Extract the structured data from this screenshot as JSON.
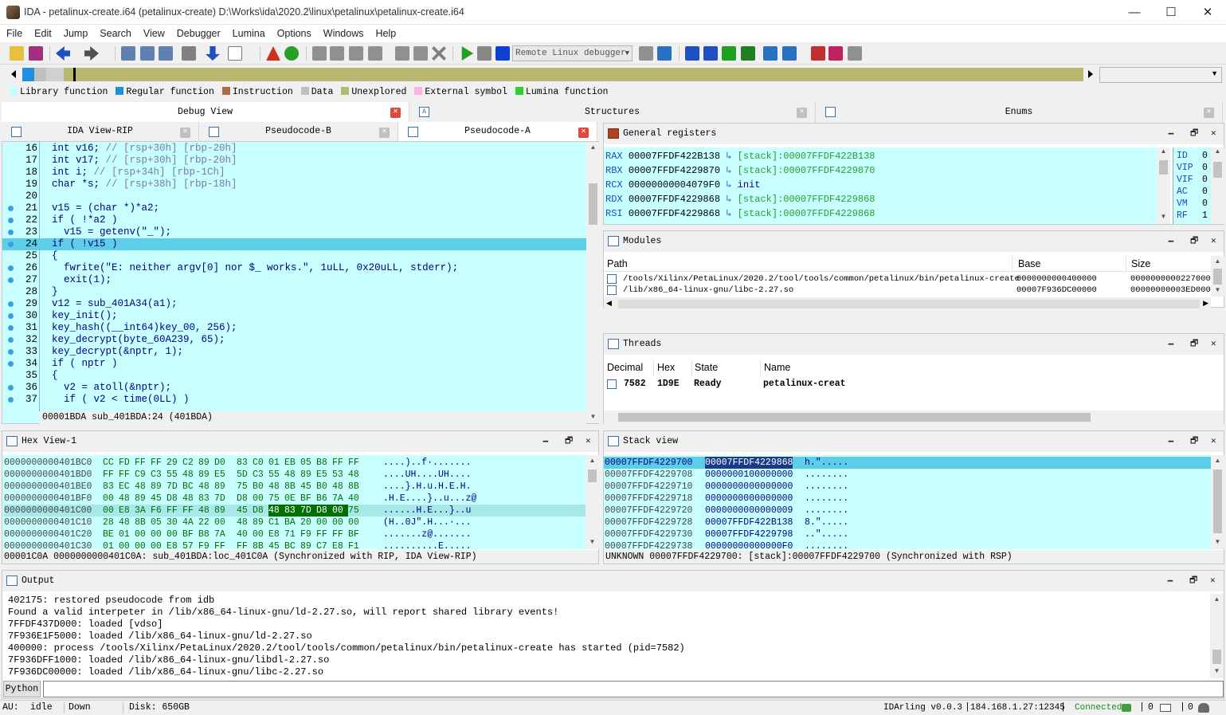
{
  "window": {
    "title": "IDA - petalinux-create.i64 (petalinux-create) D:\\Works\\ida\\2020.2\\linux\\petalinux\\petalinux-create.i64",
    "minimize": "—",
    "maximize": "☐",
    "close": "✕"
  },
  "menu": [
    "File",
    "Edit",
    "Jump",
    "Search",
    "View",
    "Debugger",
    "Lumina",
    "Options",
    "Windows",
    "Help"
  ],
  "toolbar": {
    "debugger_combo": "Remote Linux debugger"
  },
  "legend": [
    {
      "label": "Library function",
      "color": "#bfffff"
    },
    {
      "label": "Regular function",
      "color": "#1e90e0"
    },
    {
      "label": "Instruction",
      "color": "#b0684a"
    },
    {
      "label": "Data",
      "color": "#c0c0c0"
    },
    {
      "label": "Unexplored",
      "color": "#b8b870"
    },
    {
      "label": "External symbol",
      "color": "#ffb0e8"
    },
    {
      "label": "Lumina function",
      "color": "#30d030"
    }
  ],
  "top_tabs": [
    "Debug View",
    "Structures",
    "Enums"
  ],
  "sub_tabs": [
    "IDA View-RIP",
    "Pseudocode-B",
    "Pseudocode-A"
  ],
  "code": [
    {
      "n": "16",
      "bp": false,
      "t": "int v16; // [rsp+30h] [rbp-20h]"
    },
    {
      "n": "17",
      "bp": false,
      "t": "int v17; // [rsp+30h] [rbp-20h]"
    },
    {
      "n": "18",
      "bp": false,
      "t": "int i; // [rsp+34h] [rbp-1Ch]"
    },
    {
      "n": "19",
      "bp": false,
      "t": "char *s; // [rsp+38h] [rbp-18h]"
    },
    {
      "n": "20",
      "bp": false,
      "t": ""
    },
    {
      "n": "21",
      "bp": true,
      "t": "v15 = (char *)*a2;"
    },
    {
      "n": "22",
      "bp": true,
      "t": "if ( !*a2 )"
    },
    {
      "n": "23",
      "bp": true,
      "t": "  v15 = getenv(\"_\");"
    },
    {
      "n": "24",
      "bp": true,
      "t": "if ( !v15 )",
      "hl": true
    },
    {
      "n": "25",
      "bp": false,
      "t": "{"
    },
    {
      "n": "26",
      "bp": true,
      "t": "  fwrite(\"E: neither argv[0] nor $_ works.\", 1uLL, 0x20uLL, stderr);"
    },
    {
      "n": "27",
      "bp": true,
      "t": "  exit(1);"
    },
    {
      "n": "28",
      "bp": false,
      "t": "}"
    },
    {
      "n": "29",
      "bp": true,
      "t": "v12 = sub_401A34(a1);"
    },
    {
      "n": "30",
      "bp": true,
      "t": "key_init();"
    },
    {
      "n": "31",
      "bp": true,
      "t": "key_hash((__int64)key_00, 256);"
    },
    {
      "n": "32",
      "bp": true,
      "t": "key_decrypt(byte_60A239, 65);"
    },
    {
      "n": "33",
      "bp": true,
      "t": "key_decrypt(&nptr, 1);"
    },
    {
      "n": "34",
      "bp": true,
      "t": "if ( nptr )"
    },
    {
      "n": "35",
      "bp": false,
      "t": "{"
    },
    {
      "n": "36",
      "bp": true,
      "t": "  v2 = atoll(&nptr);"
    },
    {
      "n": "37",
      "bp": true,
      "t": "  if ( v2 < time(0LL) )"
    }
  ],
  "code_status": "00001BDA sub_401BDA:24 (401BDA)",
  "registers_title": "General registers",
  "registers": [
    {
      "name": "RAX",
      "value": "00007FFDF422B138",
      "ref": "[stack]:00007FFDF422B138"
    },
    {
      "name": "RBX",
      "value": "00007FFDF4229870",
      "ref": "[stack]:00007FFDF4229870"
    },
    {
      "name": "RCX",
      "value": "00000000004079F0",
      "ref": "init"
    },
    {
      "name": "RDX",
      "value": "00007FFDF4229868",
      "ref": "[stack]:00007FFDF4229868"
    },
    {
      "name": "RSI",
      "value": "00007FFDF4229868",
      "ref": "[stack]:00007FFDF4229868"
    }
  ],
  "flags": [
    {
      "name": "ID",
      "value": "0"
    },
    {
      "name": "VIP",
      "value": "0"
    },
    {
      "name": "VIF",
      "value": "0"
    },
    {
      "name": "AC",
      "value": "0"
    },
    {
      "name": "VM",
      "value": "0"
    },
    {
      "name": "RF",
      "value": "1"
    }
  ],
  "modules": {
    "title": "Modules",
    "cols": [
      "Path",
      "Base",
      "Size"
    ],
    "rows": [
      {
        "path": "/tools/Xilinx/PetaLinux/2020.2/tool/tools/common/petalinux/bin/petalinux-create",
        "base": "0000000000400000",
        "size": "0000000000227000"
      },
      {
        "path": "/lib/x86_64-linux-gnu/libc-2.27.so",
        "base": "00007F936DC00000",
        "size": "00000000003ED000"
      }
    ]
  },
  "threads": {
    "title": "Threads",
    "cols": [
      "Decimal",
      "Hex",
      "State",
      "Name"
    ],
    "rows": [
      {
        "dec": "7582",
        "hex": "1D9E",
        "state": "Ready",
        "name": "petalinux-creat"
      }
    ]
  },
  "hex": {
    "title": "Hex View-1",
    "rows": [
      {
        "a": "0000000000401BC0",
        "b": [
          "CC",
          "FD",
          "FF",
          "FF",
          "29",
          "C2",
          "89",
          "D0",
          "83",
          "C0",
          "01",
          "EB",
          "05",
          "B8",
          "FF",
          "FF"
        ],
        "s": "....)..f·......."
      },
      {
        "a": "0000000000401BD0",
        "b": [
          "FF",
          "FF",
          "C9",
          "C3",
          "55",
          "48",
          "89",
          "E5",
          "5D",
          "C3",
          "55",
          "48",
          "89",
          "E5",
          "53",
          "48"
        ],
        "s": "....UH....UH...."
      },
      {
        "a": "0000000000401BE0",
        "b": [
          "83",
          "EC",
          "48",
          "89",
          "7D",
          "BC",
          "48",
          "89",
          "75",
          "B0",
          "48",
          "8B",
          "45",
          "B0",
          "48",
          "8B"
        ],
        "s": "....}.H.u.H.E.H."
      },
      {
        "a": "0000000000401BF0",
        "b": [
          "00",
          "48",
          "89",
          "45",
          "D8",
          "48",
          "83",
          "7D",
          "D8",
          "00",
          "75",
          "0E",
          "BF",
          "B6",
          "7A",
          "40"
        ],
        "s": ".H.E....}..u...z@"
      },
      {
        "a": "0000000000401C00",
        "b": [
          "00",
          "E8",
          "3A",
          "F6",
          "FF",
          "FF",
          "48",
          "89",
          "45",
          "D8",
          "48",
          "83",
          "7D",
          "D8",
          "00",
          "75"
        ],
        "s": "......H.E...}..u",
        "hl": [
          10,
          14
        ]
      },
      {
        "a": "0000000000401C10",
        "b": [
          "28",
          "48",
          "8B",
          "05",
          "30",
          "4A",
          "22",
          "00",
          "48",
          "89",
          "C1",
          "BA",
          "20",
          "00",
          "00",
          "00"
        ],
        "s": "(H..0J\".H...·..."
      },
      {
        "a": "0000000000401C20",
        "b": [
          "BE",
          "01",
          "00",
          "00",
          "00",
          "BF",
          "B8",
          "7A",
          "40",
          "00",
          "E8",
          "71",
          "F9",
          "FF",
          "FF",
          "BF"
        ],
        "s": ".......z@......."
      },
      {
        "a": "0000000000401C30",
        "b": [
          "01",
          "00",
          "00",
          "00",
          "E8",
          "57",
          "F9",
          "FF",
          "FF",
          "8B",
          "45",
          "BC",
          "89",
          "C7",
          "E8",
          "F1"
        ],
        "s": "..........E....."
      }
    ],
    "status": "00001C0A 0000000000401C0A: sub_401BDA:loc_401C0A (Synchronized with RIP, IDA View-RIP)"
  },
  "stack": {
    "title": "Stack view",
    "rows": [
      {
        "a": "00007FFDF4229700",
        "v": "00007FFDF4229868",
        "s": "h.\".....",
        "sel": true
      },
      {
        "a": "00007FFDF4229708",
        "v": "0000000100000000",
        "s": "........"
      },
      {
        "a": "00007FFDF4229710",
        "v": "0000000000000000",
        "s": "........"
      },
      {
        "a": "00007FFDF4229718",
        "v": "0000000000000000",
        "s": "........"
      },
      {
        "a": "00007FFDF4229720",
        "v": "0000000000000009",
        "s": "........"
      },
      {
        "a": "00007FFDF4229728",
        "v": "00007FFDF422B138",
        "s": "8.\"....."
      },
      {
        "a": "00007FFDF4229730",
        "v": "00007FFDF4229798",
        "s": "..\"....."
      },
      {
        "a": "00007FFDF4229738",
        "v": "00000000000000F0",
        "s": "........"
      }
    ],
    "status": "UNKNOWN 00007FFDF4229700: [stack]:00007FFDF4229700 (Synchronized with RSP)"
  },
  "output": {
    "title": "Output",
    "lines": [
      "402175: restored pseudocode from idb",
      "Found a valid interpeter in /lib/x86_64-linux-gnu/ld-2.27.so, will report shared library events!",
      "7FFDF437D000: loaded [vdso]",
      "7F936E1F5000: loaded /lib/x86_64-linux-gnu/ld-2.27.so",
      "400000: process /tools/Xilinx/PetaLinux/2020.2/tool/tools/common/petalinux/bin/petalinux-create has started (pid=7582)",
      "7F936DFF1000: loaded /lib/x86_64-linux-gnu/libdl-2.27.so",
      "7F936DC00000: loaded /lib/x86_64-linux-gnu/libc-2.27.so"
    ],
    "python_btn": "Python",
    "python_input": ""
  },
  "status": {
    "au": "AU:",
    "state": "idle",
    "dir": "Down",
    "disk": "Disk: 650GB",
    "idarling": "IDArling v0.0.3",
    "server": "184.168.1.27:12345",
    "conn": "Connected",
    "c1": "0",
    "c2": "0"
  }
}
